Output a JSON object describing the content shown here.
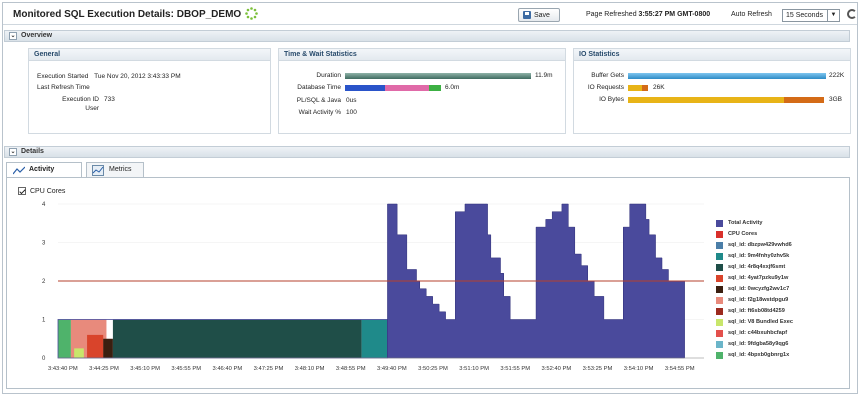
{
  "header": {
    "title": "Monitored SQL Execution Details: DBOP_DEMO",
    "save_label": "Save",
    "page_refreshed_label": "Page Refreshed",
    "page_refreshed_time": "3:55:27 PM GMT-0800",
    "auto_refresh_label": "Auto Refresh",
    "auto_refresh_value": "15 Seconds"
  },
  "overview": {
    "label": "Overview",
    "general": {
      "title": "General",
      "execution_started_label": "Execution Started",
      "execution_started_value": "Tue Nov 20, 2012 3:43:33 PM",
      "last_refresh_label": "Last Refresh Time",
      "execution_id_label": "Execution ID",
      "execution_id_value": "733",
      "user_label": "User"
    },
    "time_wait": {
      "title": "Time & Wait Statistics",
      "duration_label": "Duration",
      "duration_value": "11.9m",
      "db_time_label": "Database Time",
      "db_time_value": "6.0m",
      "plsql_label": "PL/SQL & Java",
      "plsql_value": "0us",
      "wait_label": "Wait Activity %",
      "wait_value": "100"
    },
    "io": {
      "title": "IO Statistics",
      "buffer_gets_label": "Buffer Gets",
      "buffer_gets_value": "222K",
      "io_requests_label": "IO Requests",
      "io_requests_value": "26K",
      "io_bytes_label": "IO Bytes",
      "io_bytes_value": "3GB"
    }
  },
  "details": {
    "label": "Details",
    "tabs": [
      {
        "label": "Activity",
        "active": true,
        "icon": "activity-chart-icon"
      },
      {
        "label": "Metrics",
        "active": false,
        "icon": "metrics-icon"
      }
    ],
    "cpu_cores_checkbox_label": "CPU Cores",
    "cpu_cores_checked": true
  },
  "colors": {
    "accent_title": "#274a6b",
    "total_activity": "#4a4a9c",
    "cpu_cores_line": "#c0392b"
  },
  "chart_data": {
    "type": "area",
    "y_ticks": [
      "0",
      "1",
      "2",
      "3",
      "4"
    ],
    "ylim": [
      0,
      4
    ],
    "x_tick_labels": [
      "3:43:40 PM",
      "3:44:25 PM",
      "3:45:10 PM",
      "3:45:55 PM",
      "3:46:40 PM",
      "3:47:25 PM",
      "3:48:10 PM",
      "3:48:55 PM",
      "3:49:40 PM",
      "3:50:25 PM",
      "3:51:10 PM",
      "3:51:55 PM",
      "3:52:40 PM",
      "3:53:25 PM",
      "3:54:10 PM",
      "3:54:55 PM"
    ],
    "cpu_cores": 2,
    "grid": true,
    "legend_position": "right",
    "series": [
      {
        "name": "Total Activity",
        "color": "#4a4a9c"
      },
      {
        "name": "CPU Cores",
        "color": "#d9302b"
      },
      {
        "name": "sql_id: dbzpw429vwhd6",
        "color": "#4b7ea8"
      },
      {
        "name": "sql_id: 9m4fnhy0zhv5k",
        "color": "#1f8a8a"
      },
      {
        "name": "sql_id: 4r8q4xxjf6smt",
        "color": "#1f4e48"
      },
      {
        "name": "sql_id: 4yat7pzku9y1w",
        "color": "#d9442b"
      },
      {
        "name": "sql_id: 0wcyzfg2wv1c7",
        "color": "#3a1f10"
      },
      {
        "name": "sql_id: f2g18wstdpgu9",
        "color": "#e88a7c"
      },
      {
        "name": "sql_id: ft6sb08td4259",
        "color": "#9c2a1f"
      },
      {
        "name": "sql_id: V8 Bundled Exec",
        "color": "#c8e66b"
      },
      {
        "name": "sql_id: c44bxuhbcfapf",
        "color": "#e3504c"
      },
      {
        "name": "sql_id: 9fdgba58y9qg6",
        "color": "#6bb5c9"
      },
      {
        "name": "sql_id: 4bpxb0gbnrg1x",
        "color": "#4fb36b"
      }
    ],
    "phase1_composition": [
      {
        "color": "#4fb36b",
        "t0": 0.0,
        "t1": 0.02,
        "v": 1
      },
      {
        "color": "#e88a7c",
        "t0": 0.02,
        "t1": 0.075,
        "v": 1
      },
      {
        "color": "#d9442b",
        "t0": 0.045,
        "t1": 0.07,
        "v": 0.6
      },
      {
        "color": "#c8e66b",
        "t0": 0.025,
        "t1": 0.04,
        "v": 0.25
      },
      {
        "color": "#3a1f10",
        "t0": 0.07,
        "t1": 0.085,
        "v": 0.5
      },
      {
        "color": "#1f4e48",
        "t0": 0.085,
        "t1": 0.47,
        "v": 1
      },
      {
        "color": "#1f8a8a",
        "t0": 0.47,
        "t1": 0.51,
        "v": 1
      }
    ],
    "total_activity_profile": [
      [
        0.51,
        4
      ],
      [
        0.525,
        3.2
      ],
      [
        0.54,
        2.3
      ],
      [
        0.555,
        2
      ],
      [
        0.56,
        1.8
      ],
      [
        0.57,
        1.6
      ],
      [
        0.58,
        1.4
      ],
      [
        0.59,
        1.2
      ],
      [
        0.6,
        1
      ],
      [
        0.615,
        3.8
      ],
      [
        0.63,
        4
      ],
      [
        0.66,
        4
      ],
      [
        0.665,
        3.2
      ],
      [
        0.67,
        2.6
      ],
      [
        0.685,
        2.2
      ],
      [
        0.69,
        1.6
      ],
      [
        0.7,
        1
      ],
      [
        0.74,
        3.4
      ],
      [
        0.755,
        3.6
      ],
      [
        0.765,
        3.8
      ],
      [
        0.78,
        4
      ],
      [
        0.79,
        3.4
      ],
      [
        0.8,
        2.7
      ],
      [
        0.81,
        2.4
      ],
      [
        0.82,
        2
      ],
      [
        0.83,
        1.6
      ],
      [
        0.845,
        1
      ],
      [
        0.875,
        3.4
      ],
      [
        0.885,
        4
      ],
      [
        0.9,
        4
      ],
      [
        0.91,
        3.6
      ],
      [
        0.915,
        3.2
      ],
      [
        0.925,
        2.6
      ],
      [
        0.935,
        2.3
      ],
      [
        0.945,
        2
      ],
      [
        0.97,
        2
      ]
    ]
  }
}
